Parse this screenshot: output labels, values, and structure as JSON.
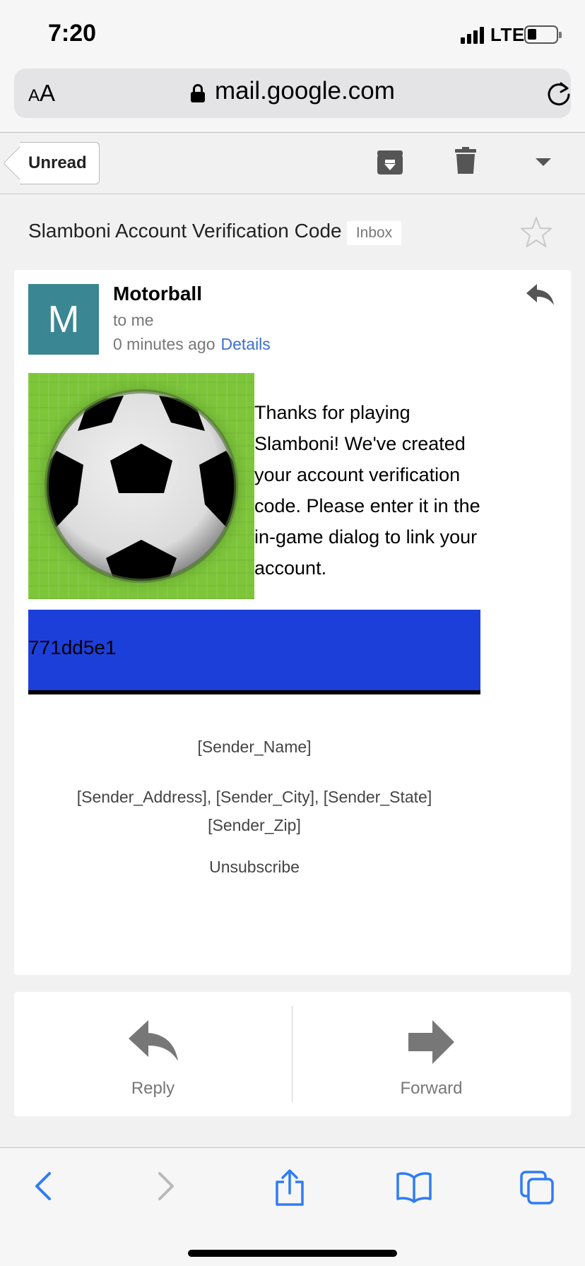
{
  "status_bar": {
    "time": "7:20",
    "network": "LTE"
  },
  "browser": {
    "text_size_small": "A",
    "text_size_big": "A",
    "url": "mail.google.com"
  },
  "toolbar": {
    "back_label": "Unread"
  },
  "email": {
    "subject": "Slamboni Account Verification Code",
    "label": "Inbox",
    "avatar_letter": "M",
    "sender": "Motorball",
    "recipient": "to me",
    "time_ago": "0 minutes ago",
    "details_link": "Details",
    "body_text": "Thanks for playing Slamboni!  We've created your account verification code.  Please enter it in the in-game dialog to link your account.",
    "verification_code": "771dd5e1",
    "footer_name": "[Sender_Name]",
    "footer_address": "[Sender_Address], [Sender_City], [Sender_State] [Sender_Zip]",
    "unsubscribe": "Unsubscribe"
  },
  "actions": {
    "reply": "Reply",
    "forward": "Forward"
  },
  "colors": {
    "avatar_bg": "#3a8693",
    "code_box_bg": "#1d3fd9",
    "link": "#3b6fd1",
    "safari_blue": "#2f7cf6"
  }
}
